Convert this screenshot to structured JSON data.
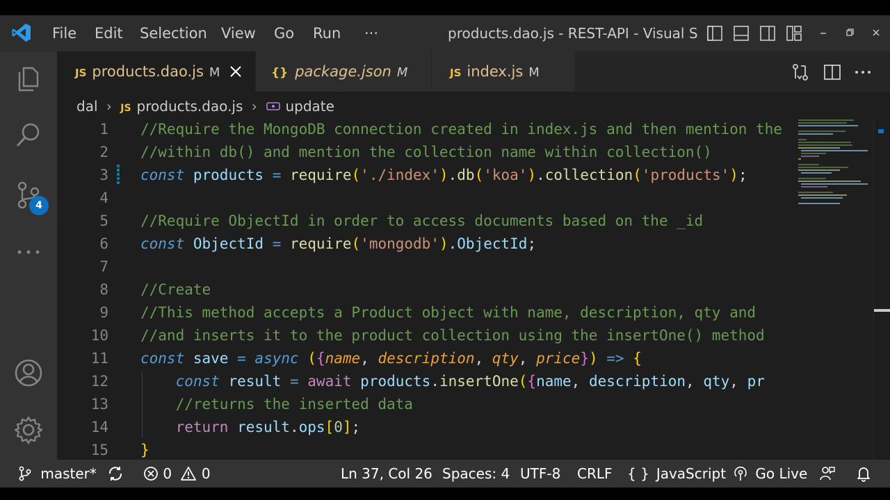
{
  "menu": {
    "file": "File",
    "edit": "Edit",
    "selection": "Selection",
    "view": "View",
    "go": "Go",
    "run": "Run",
    "more": "···"
  },
  "window_title": "products.dao.js - REST-API - Visual St...",
  "tabs": [
    {
      "badge": "JS",
      "label": "products.dao.js",
      "status": "M",
      "active": true
    },
    {
      "badge": "{}",
      "label": "package.json",
      "status": "M",
      "active": false
    },
    {
      "badge": "JS",
      "label": "index.js",
      "status": "M",
      "active": false
    }
  ],
  "breadcrumb": {
    "folder": "dal",
    "file_badge": "JS",
    "file": "products.dao.js",
    "symbol": "update"
  },
  "activity": {
    "scm_badge": "4"
  },
  "code_lines": [
    {
      "n": "1",
      "text": "//Require the MongoDB connection created in index.js and then mention the"
    },
    {
      "n": "2",
      "text": "//within db() and mention the collection name within collection()"
    },
    {
      "n": "3",
      "text": "const products = require('./index').db('koa').collection('products');"
    },
    {
      "n": "4",
      "text": ""
    },
    {
      "n": "5",
      "text": "//Require ObjectId in order to access documents based on the _id"
    },
    {
      "n": "6",
      "text": "const ObjectId = require('mongodb').ObjectId;"
    },
    {
      "n": "7",
      "text": ""
    },
    {
      "n": "8",
      "text": "//Create"
    },
    {
      "n": "9",
      "text": "//This method accepts a Product object with name, description, qty and"
    },
    {
      "n": "10",
      "text": "//and inserts it to the product collection using the insertOne() method"
    },
    {
      "n": "11",
      "text": "const save = async ({name, description, qty, price}) => {"
    },
    {
      "n": "12",
      "text": "    const result = await products.insertOne({name, description, qty, pr"
    },
    {
      "n": "13",
      "text": "    //returns the inserted data"
    },
    {
      "n": "14",
      "text": "    return result.ops[0];"
    },
    {
      "n": "15",
      "text": "}"
    }
  ],
  "status": {
    "branch": "master*",
    "errors": "0",
    "warnings": "0",
    "position": "Ln 37, Col 26",
    "spaces": "Spaces: 4",
    "encoding": "UTF-8",
    "eol": "CRLF",
    "language": "JavaScript",
    "golive": "Go Live"
  },
  "colors": {
    "accent": "#0e70c0",
    "titlebar": "#2d2d2d",
    "editor_bg": "#1e1e1e",
    "statusbar": "#333333"
  }
}
